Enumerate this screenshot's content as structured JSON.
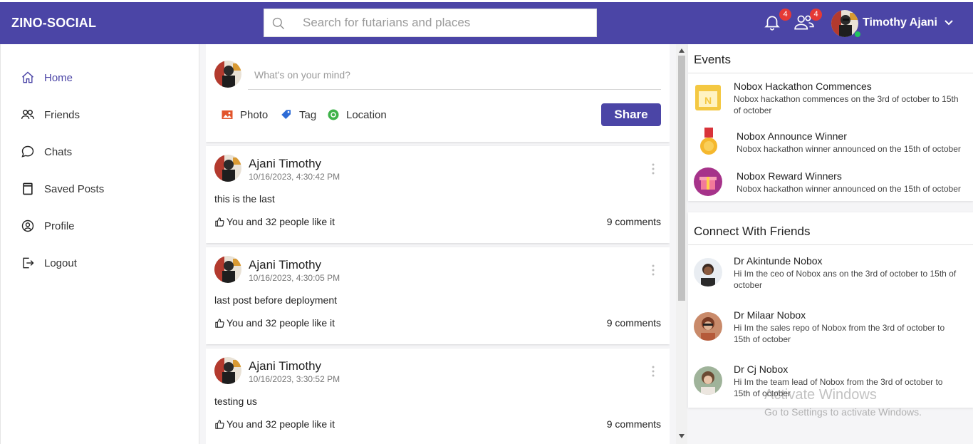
{
  "header": {
    "logo": "ZINO-SOCIAL",
    "search_placeholder": "Search for futarians and places",
    "notifications_count": "4",
    "friend_requests_count": "4",
    "user_name": "Timothy Ajani",
    "brand_color": "#4b45a6"
  },
  "sidebar": {
    "items": [
      {
        "label": "Home",
        "icon": "home-icon"
      },
      {
        "label": "Friends",
        "icon": "friends-icon"
      },
      {
        "label": "Chats",
        "icon": "chat-icon"
      },
      {
        "label": "Saved Posts",
        "icon": "bookmark-icon"
      },
      {
        "label": "Profile",
        "icon": "user-circle-icon"
      },
      {
        "label": "Logout",
        "icon": "logout-icon"
      }
    ]
  },
  "composer": {
    "placeholder": "What's on your mind?",
    "photo_label": "Photo",
    "tag_label": "Tag",
    "location_label": "Location",
    "share_label": "Share"
  },
  "posts": [
    {
      "author": "Ajani Timothy",
      "time": "10/16/2023, 4:30:42 PM",
      "text": "this is the last",
      "likes": "You and 32 people like it",
      "comments": "9 comments"
    },
    {
      "author": "Ajani Timothy",
      "time": "10/16/2023, 4:30:05 PM",
      "text": "last post before deployment",
      "likes": "You and 32 people like it",
      "comments": "9 comments"
    },
    {
      "author": "Ajani Timothy",
      "time": "10/16/2023, 3:30:52 PM",
      "text": "testing us",
      "likes": "You and 32 people like it",
      "comments": "9 comments"
    }
  ],
  "events": {
    "title": "Events",
    "items": [
      {
        "title": "Nobox Hackathon Commences",
        "desc_line1": "Nobox hackathon commences on the 3rd of october to 15th",
        "desc_line2": "of october"
      },
      {
        "title": "Nobox Announce Winner",
        "desc_line1": "Nobox hackathon winner announced on the 15th of october",
        "desc_line2": ""
      },
      {
        "title": "Nobox Reward Winners",
        "desc_line1": "Nobox hackathon winner announced on the 15th of october",
        "desc_line2": ""
      }
    ]
  },
  "friends": {
    "title": "Connect With Friends",
    "items": [
      {
        "name": "Dr Akintunde Nobox",
        "desc_line1": "Hi Im the ceo of Nobox ans on the 3rd of october to 15th of",
        "desc_line2": "october"
      },
      {
        "name": "Dr Milaar Nobox",
        "desc_line1": "Hi Im the sales repo of Nobox from the 3rd of october to",
        "desc_line2": "15th of october"
      },
      {
        "name": "Dr Cj Nobox",
        "desc_line1": "Hi Im the team lead of Nobox from the 3rd of october to",
        "desc_line2": "15th of october"
      }
    ]
  },
  "watermark": {
    "line1": "Activate Windows",
    "line2": "Go to Settings to activate Windows."
  }
}
